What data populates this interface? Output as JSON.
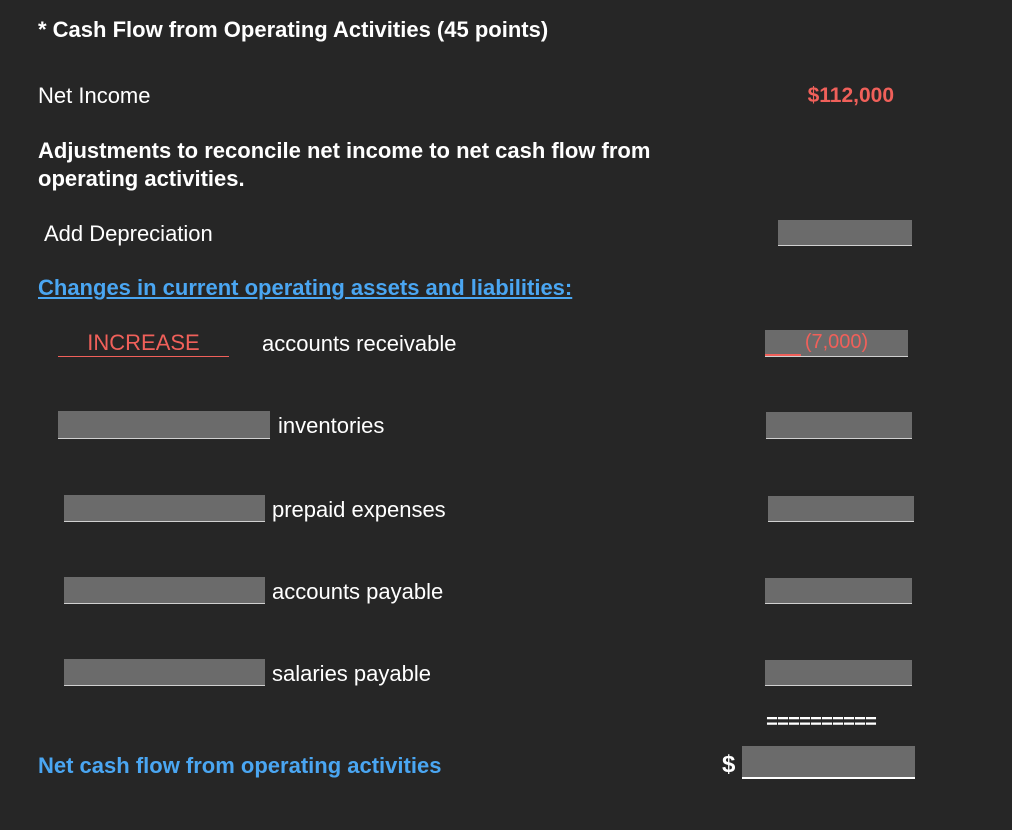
{
  "title": "* Cash Flow from Operating Activities (45 points)",
  "net_income": {
    "label": "Net Income",
    "value": "$112,000"
  },
  "adjustments_heading": "Adjustments to reconcile net income to net cash flow from operating activities.",
  "depreciation_label": "Add Depreciation",
  "changes_heading": "Changes in current operating assets and liabilities:",
  "rows": [
    {
      "direction": "INCREASE",
      "item": "accounts receivable",
      "amount": "(7,000)"
    },
    {
      "direction": "",
      "item": "inventories",
      "amount": ""
    },
    {
      "direction": "",
      "item": "prepaid expenses",
      "amount": ""
    },
    {
      "direction": "",
      "item": "accounts payable",
      "amount": ""
    },
    {
      "direction": "",
      "item": "salaries payable",
      "amount": ""
    }
  ],
  "double_rule": "==========",
  "net_cash_flow": {
    "label": "Net cash flow from operating activities",
    "currency": "$",
    "value": ""
  },
  "colors": {
    "background": "#262626",
    "accent_red": "#f0605a",
    "accent_blue": "#4aa6f2",
    "input_fill": "#6b6b6b"
  }
}
